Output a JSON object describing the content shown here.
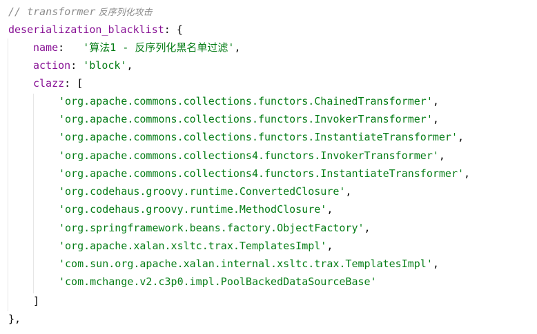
{
  "editor": {
    "comment": {
      "slashes": "// ",
      "text": "transformer",
      "cjk": " 反序列化攻击"
    },
    "block_key": "deserialization_blacklist",
    "block_open": ": {",
    "name_key": "name",
    "name_sep": ":   ",
    "name_value": "'算法1 - 反序列化黑名单过滤'",
    "action_key": "action",
    "action_sep": ": ",
    "action_value": "'block'",
    "clazz_key": "clazz",
    "clazz_open": ": [",
    "clazz_items": [
      "'org.apache.commons.collections.functors.ChainedTransformer'",
      "'org.apache.commons.collections.functors.InvokerTransformer'",
      "'org.apache.commons.collections.functors.InstantiateTransformer'",
      "'org.apache.commons.collections4.functors.InvokerTransformer'",
      "'org.apache.commons.collections4.functors.InstantiateTransformer'",
      "'org.codehaus.groovy.runtime.ConvertedClosure'",
      "'org.codehaus.groovy.runtime.MethodClosure'",
      "'org.springframework.beans.factory.ObjectFactory'",
      "'org.apache.xalan.xsltc.trax.TemplatesImpl'",
      "'com.sun.org.apache.xalan.internal.xsltc.trax.TemplatesImpl'",
      "'com.mchange.v2.c3p0.impl.PoolBackedDataSourceBase'"
    ],
    "comma": ",",
    "clazz_close": "]",
    "block_close": "},"
  }
}
